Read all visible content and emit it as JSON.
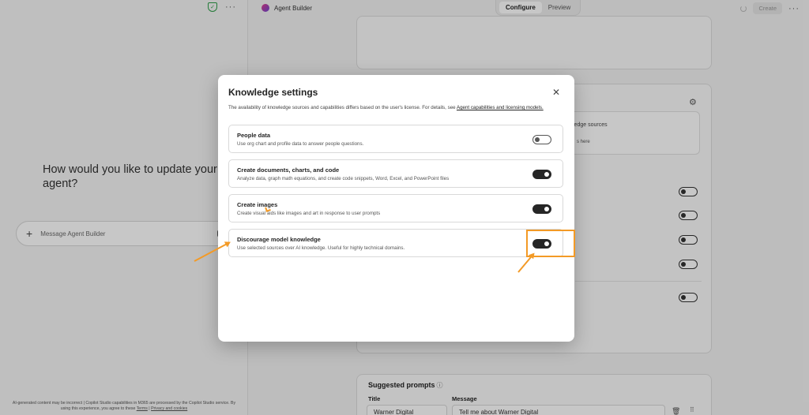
{
  "chat": {
    "heading": "How would you like to update your agent?",
    "message_placeholder": "Message Agent Builder",
    "disclaimer_prefix": "AI-generated content may be incorrect | Copilot Studio capabilities in M365 are processed by the Copilot Studio service. By using this experience, you agree to these ",
    "terms_link": "Terms",
    "separator": " | ",
    "privacy_link": "Privacy and cookies"
  },
  "header": {
    "agent_name": "Agent Builder",
    "tabs": [
      {
        "label": "Configure",
        "active": true
      },
      {
        "label": "Preview",
        "active": false
      }
    ],
    "create_label": "Create"
  },
  "background": {
    "knowledge_line1": "ledge sources",
    "knowledge_line2": "s here",
    "suggested_prompts_title": "Suggested prompts",
    "info_icon": "ⓘ",
    "col_title": "Title",
    "col_message": "Message",
    "prompt_title_value": "Warner Digital",
    "prompt_message_value": "Tell me about Warner Digital"
  },
  "modal": {
    "title": "Knowledge settings",
    "description_prefix": "The availability of knowledge sources and capabilities differs based on the user's license. For details, see ",
    "description_link": "Agent capabilities and licensing models.",
    "options": [
      {
        "title": "People data",
        "description": "Use org chart and profile data to answer people questions.",
        "enabled": false
      },
      {
        "title": "Create documents, charts, and code",
        "description": "Analyze data, graph math equations, and create code snippets, Word, Excel, and PowerPoint files",
        "enabled": true
      },
      {
        "title": "Create images",
        "description": "Create visual aids like images and art in response to user prompts",
        "enabled": true
      },
      {
        "title": "Discourage model knowledge",
        "description": "Use selected sources over AI knowledge. Useful for highly technical domains.",
        "enabled": true
      }
    ]
  },
  "colors": {
    "accent_annotation": "#f39a26",
    "toggle_on": "#262626"
  }
}
